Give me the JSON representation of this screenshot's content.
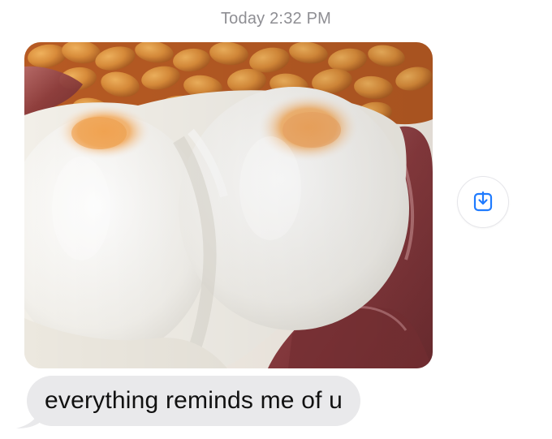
{
  "conversation": {
    "timestamp": "Today 2:32 PM",
    "messages": [
      {
        "type": "image",
        "description_icon": "photo-attachment",
        "has_save_action": true
      },
      {
        "type": "text",
        "text": "everything reminds me of u"
      }
    ]
  },
  "actions": {
    "save_icon": "download-icon"
  },
  "colors": {
    "timestamp": "#8E8E93",
    "bubble_incoming": "#E9E9EB",
    "accent": "#1F7BFF"
  }
}
